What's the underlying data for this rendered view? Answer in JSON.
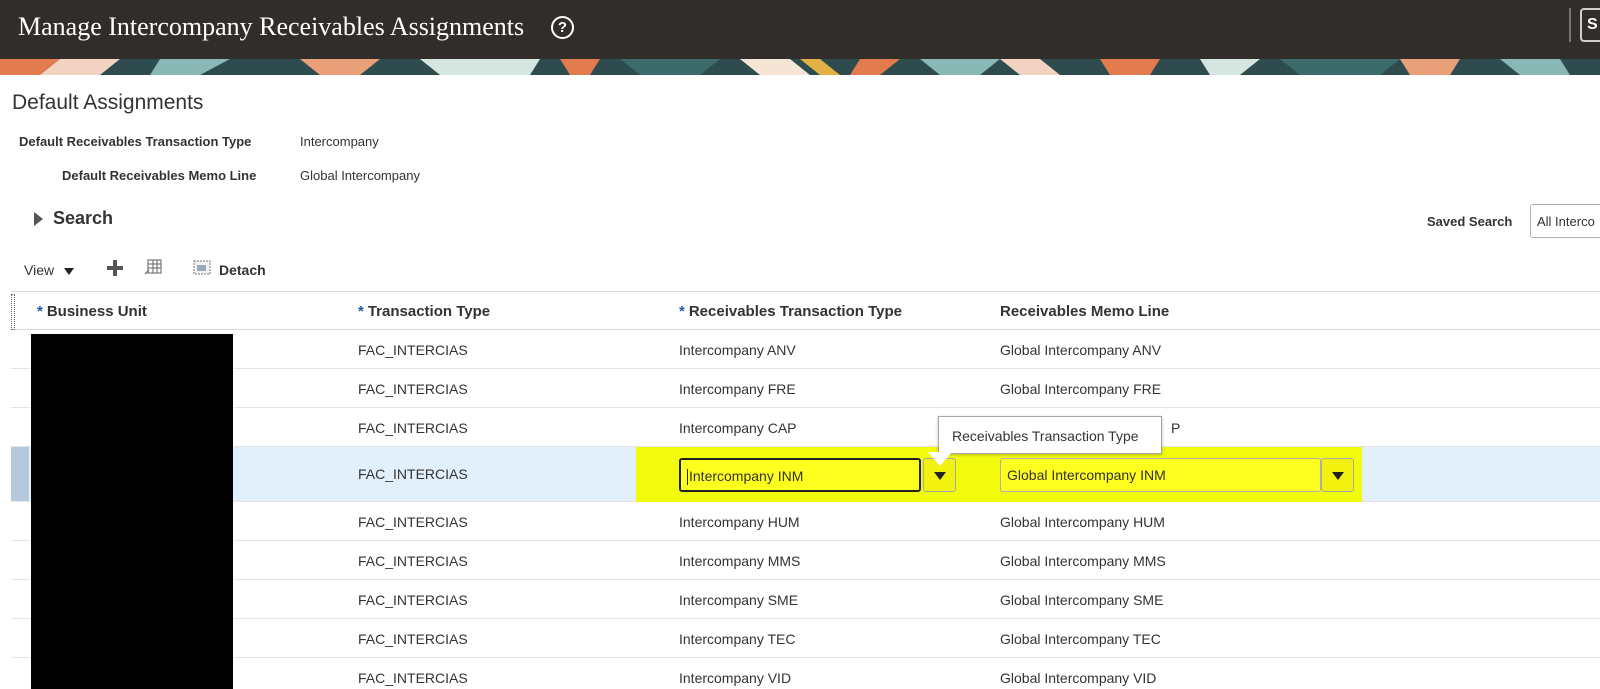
{
  "header": {
    "title": "Manage Intercompany Receivables Assignments",
    "help_glyph": "?",
    "right_button_label": "S"
  },
  "defaults": {
    "section_title": "Default Assignments",
    "transaction_type_label": "Default Receivables Transaction Type",
    "transaction_type_value": "Intercompany",
    "memo_line_label": "Default Receivables Memo Line",
    "memo_line_value": "Global Intercompany"
  },
  "search": {
    "title": "Search",
    "saved_search_label": "Saved Search",
    "saved_search_value": "All Interco"
  },
  "toolbar": {
    "view_label": "View",
    "detach_label": "Detach",
    "icons": [
      "plus-icon",
      "freeze-icon",
      "detach-icon"
    ]
  },
  "table": {
    "required_marker": "*",
    "columns": [
      {
        "label": "Business Unit",
        "required": true
      },
      {
        "label": "Transaction Type",
        "required": true
      },
      {
        "label": "Receivables Transaction Type",
        "required": true
      },
      {
        "label": "Receivables Memo Line",
        "required": false
      }
    ],
    "rows": [
      {
        "transaction_type": "FAC_INTERCIAS",
        "receivables_transaction_type": "Intercompany ANV",
        "memo_line": "Global Intercompany ANV"
      },
      {
        "transaction_type": "FAC_INTERCIAS",
        "receivables_transaction_type": "Intercompany FRE",
        "memo_line": "Global Intercompany FRE"
      },
      {
        "transaction_type": "FAC_INTERCIAS",
        "receivables_transaction_type": "Intercompany CAP",
        "memo_line": "P"
      },
      {
        "transaction_type": "FAC_INTERCIAS",
        "receivables_transaction_type": "Intercompany INM",
        "memo_line": "Global Intercompany INM",
        "selected": true
      },
      {
        "transaction_type": "FAC_INTERCIAS",
        "receivables_transaction_type": "Intercompany HUM",
        "memo_line": "Global Intercompany HUM"
      },
      {
        "transaction_type": "FAC_INTERCIAS",
        "receivables_transaction_type": "Intercompany MMS",
        "memo_line": "Global Intercompany MMS"
      },
      {
        "transaction_type": "FAC_INTERCIAS",
        "receivables_transaction_type": "Intercompany SME",
        "memo_line": "Global Intercompany SME"
      },
      {
        "transaction_type": "FAC_INTERCIAS",
        "receivables_transaction_type": "Intercompany TEC",
        "memo_line": "Global Intercompany TEC"
      },
      {
        "transaction_type": "FAC_INTERCIAS",
        "receivables_transaction_type": "Intercompany VID",
        "memo_line": "Global Intercompany VID"
      }
    ]
  },
  "tooltip": {
    "text": "Receivables Transaction Type"
  },
  "colors": {
    "header_bg": "#312d2a",
    "highlight": "#f2fb0e",
    "selected_row": "#e2f0fb",
    "required_marker": "#1a5aa6"
  }
}
